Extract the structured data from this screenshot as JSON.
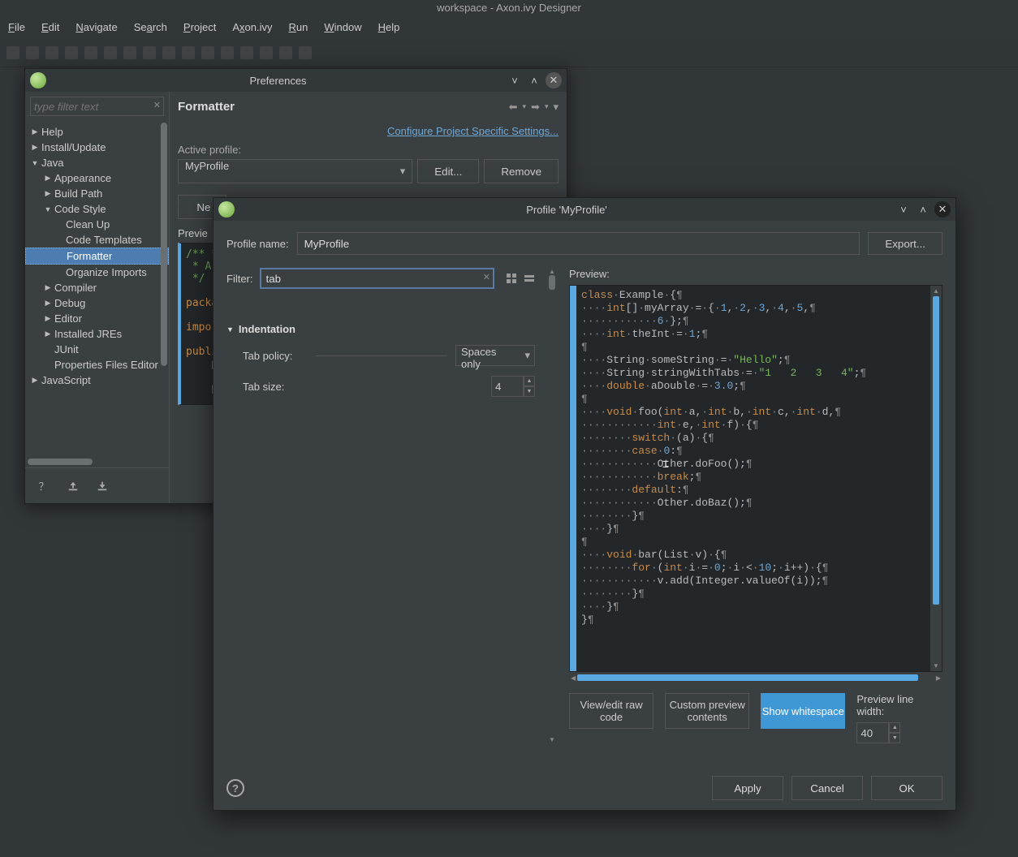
{
  "app": {
    "title": "workspace - Axon.ivy Designer"
  },
  "menubar": [
    "File",
    "Edit",
    "Navigate",
    "Search",
    "Project",
    "Axon.ivy",
    "Run",
    "Window",
    "Help"
  ],
  "prefs": {
    "title": "Preferences",
    "filter_placeholder": "type filter text",
    "tree": {
      "help": "Help",
      "install": "Install/Update",
      "java": "Java",
      "appearance": "Appearance",
      "buildpath": "Build Path",
      "codestyle": "Code Style",
      "cleanup": "Clean Up",
      "codetemplates": "Code Templates",
      "formatter": "Formatter",
      "organize": "Organize Imports",
      "compiler": "Compiler",
      "debug": "Debug",
      "editor": "Editor",
      "jres": "Installed JREs",
      "junit": "JUnit",
      "propfiles": "Properties Files Editor",
      "javascript": "JavaScript"
    },
    "page": {
      "heading": "Formatter",
      "link": "Configure Project Specific Settings...",
      "active_profile_label": "Active profile:",
      "active_profile_value": "MyProfile",
      "edit": "Edit...",
      "remove": "Remove",
      "new": "New...",
      "preview_label": "Preview:",
      "code": "/** *\n* A s\n*/\n\npacka\n\nimpor\n\npubli\n    p\n\n    p"
    }
  },
  "profile": {
    "title": "Profile 'MyProfile'",
    "name_label": "Profile name:",
    "name_value": "MyProfile",
    "export": "Export...",
    "filter_label": "Filter:",
    "filter_value": "tab",
    "section": "Indentation",
    "tab_policy_label": "Tab policy:",
    "tab_policy_value": "Spaces only",
    "tab_size_label": "Tab size:",
    "tab_size_value": "4",
    "preview_label": "Preview:",
    "bottom": {
      "raw": "View/edit raw code",
      "custom": "Custom preview contents",
      "whitespace": "Show whitespace",
      "width_label": "Preview line width:",
      "width_value": "40"
    },
    "buttons": {
      "apply": "Apply",
      "cancel": "Cancel",
      "ok": "OK"
    }
  }
}
